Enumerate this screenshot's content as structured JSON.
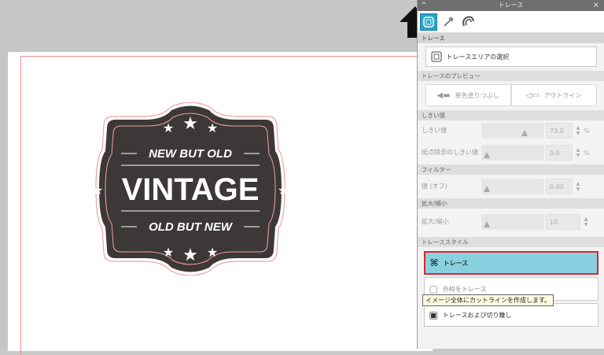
{
  "panel": {
    "title": "トレース",
    "collapse_glyph": "^",
    "close_glyph": "×",
    "toolbar": {
      "tools": [
        "trace-tool",
        "eyedropper-tool",
        "magnet-tool"
      ]
    },
    "trace_section": {
      "header": "トレース",
      "select_area_label": "トレースエリアの選択"
    },
    "preview_section": {
      "header": "トレースのプレビュー",
      "single_color_label": "単色塗りつぶし",
      "outline_label": "アウトライン"
    },
    "threshold_section": {
      "header": "しきい値",
      "threshold_label": "しきい値",
      "threshold_value": "73.0",
      "threshold_level": 0.73,
      "threshold_unit": "%",
      "despeckle_label": "斑点除去のしきい値",
      "despeckle_value": "0.0",
      "despeckle_level": 0.0,
      "despeckle_unit": "%"
    },
    "filter_section": {
      "header": "フィルター",
      "value_label": "値 (オフ)",
      "value": "0.00",
      "level": 0.0
    },
    "scale_section": {
      "header": "拡大/縮小",
      "label": "拡大/縮小",
      "value": "10",
      "level": 0.0
    },
    "style_section": {
      "header": "トレーススタイル",
      "trace_label": "トレース",
      "outer_edge_label": "外枠をトレース",
      "trace_and_detach_label": "トレースおよび切り離し"
    }
  },
  "tooltip": "イメージ全体にカットラインを作成します。",
  "badge": {
    "line1": "NEW BUT OLD",
    "line2": "VINTAGE",
    "line3": "OLD BUT NEW"
  },
  "colors": {
    "badge_fill": "#3d3838",
    "badge_outline": "#f2a0a0",
    "active_tool": "#27a6c9",
    "selected_style": "#89d1e0",
    "highlight_border": "#d9262b"
  }
}
